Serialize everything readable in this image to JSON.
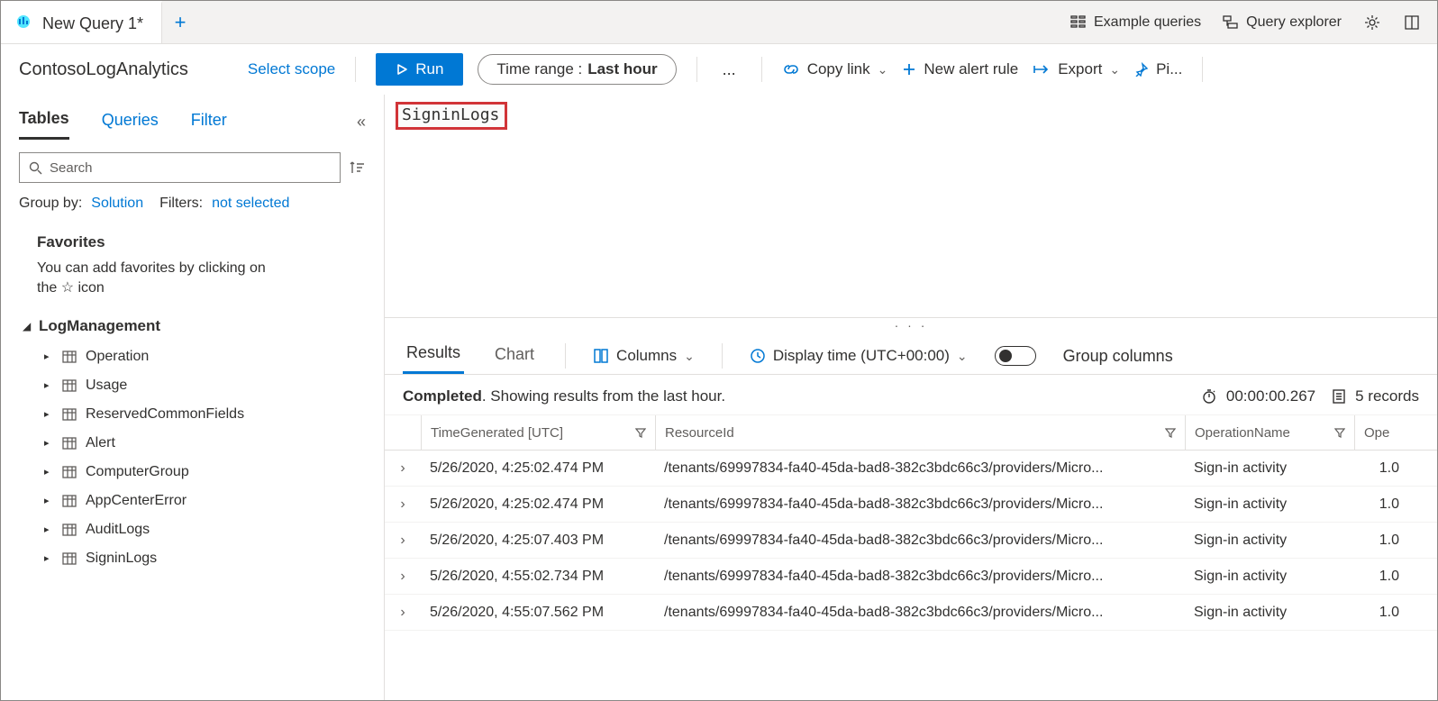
{
  "tabs": {
    "query_tab": "New Query 1*"
  },
  "topright": {
    "example_queries": "Example queries",
    "query_explorer": "Query explorer"
  },
  "scope": {
    "workspace": "ContosoLogAnalytics",
    "select_scope": "Select scope"
  },
  "toolbar": {
    "run": "Run",
    "time_range_label": "Time range :",
    "time_range_value": "Last hour",
    "copy_link": "Copy link",
    "new_alert": "New alert rule",
    "export": "Export",
    "pin": "Pi..."
  },
  "sidebar": {
    "tabs": {
      "tables": "Tables",
      "queries": "Queries",
      "filter": "Filter"
    },
    "search_placeholder": "Search",
    "groupby_label": "Group by:",
    "groupby_value": "Solution",
    "filters_label": "Filters:",
    "filters_value": "not selected",
    "favorites_header": "Favorites",
    "favorites_desc_1": "You can add favorites by clicking on",
    "favorites_desc_2": "the ☆ icon",
    "tree_root": "LogManagement",
    "tree_items": [
      "Operation",
      "Usage",
      "ReservedCommonFields",
      "Alert",
      "ComputerGroup",
      "AppCenterError",
      "AuditLogs",
      "SigninLogs"
    ]
  },
  "editor": {
    "query_text": "SigninLogs"
  },
  "results_tabs": {
    "results": "Results",
    "chart": "Chart",
    "columns": "Columns",
    "display_time": "Display time (UTC+00:00)",
    "group_columns": "Group columns"
  },
  "status": {
    "completed": "Completed",
    "summary": ". Showing results from the last hour.",
    "duration": "00:00:00.267",
    "records": "5 records"
  },
  "grid": {
    "headers": {
      "time": "TimeGenerated [UTC]",
      "resource": "ResourceId",
      "operation": "OperationName",
      "other": "Ope"
    },
    "rows": [
      {
        "time": "5/26/2020, 4:25:02.474 PM",
        "resource": "/tenants/69997834-fa40-45da-bad8-382c3bdc66c3/providers/Micro...",
        "operation": "Sign-in activity",
        "ver": "1.0"
      },
      {
        "time": "5/26/2020, 4:25:02.474 PM",
        "resource": "/tenants/69997834-fa40-45da-bad8-382c3bdc66c3/providers/Micro...",
        "operation": "Sign-in activity",
        "ver": "1.0"
      },
      {
        "time": "5/26/2020, 4:25:07.403 PM",
        "resource": "/tenants/69997834-fa40-45da-bad8-382c3bdc66c3/providers/Micro...",
        "operation": "Sign-in activity",
        "ver": "1.0"
      },
      {
        "time": "5/26/2020, 4:55:02.734 PM",
        "resource": "/tenants/69997834-fa40-45da-bad8-382c3bdc66c3/providers/Micro...",
        "operation": "Sign-in activity",
        "ver": "1.0"
      },
      {
        "time": "5/26/2020, 4:55:07.562 PM",
        "resource": "/tenants/69997834-fa40-45da-bad8-382c3bdc66c3/providers/Micro...",
        "operation": "Sign-in activity",
        "ver": "1.0"
      }
    ]
  }
}
